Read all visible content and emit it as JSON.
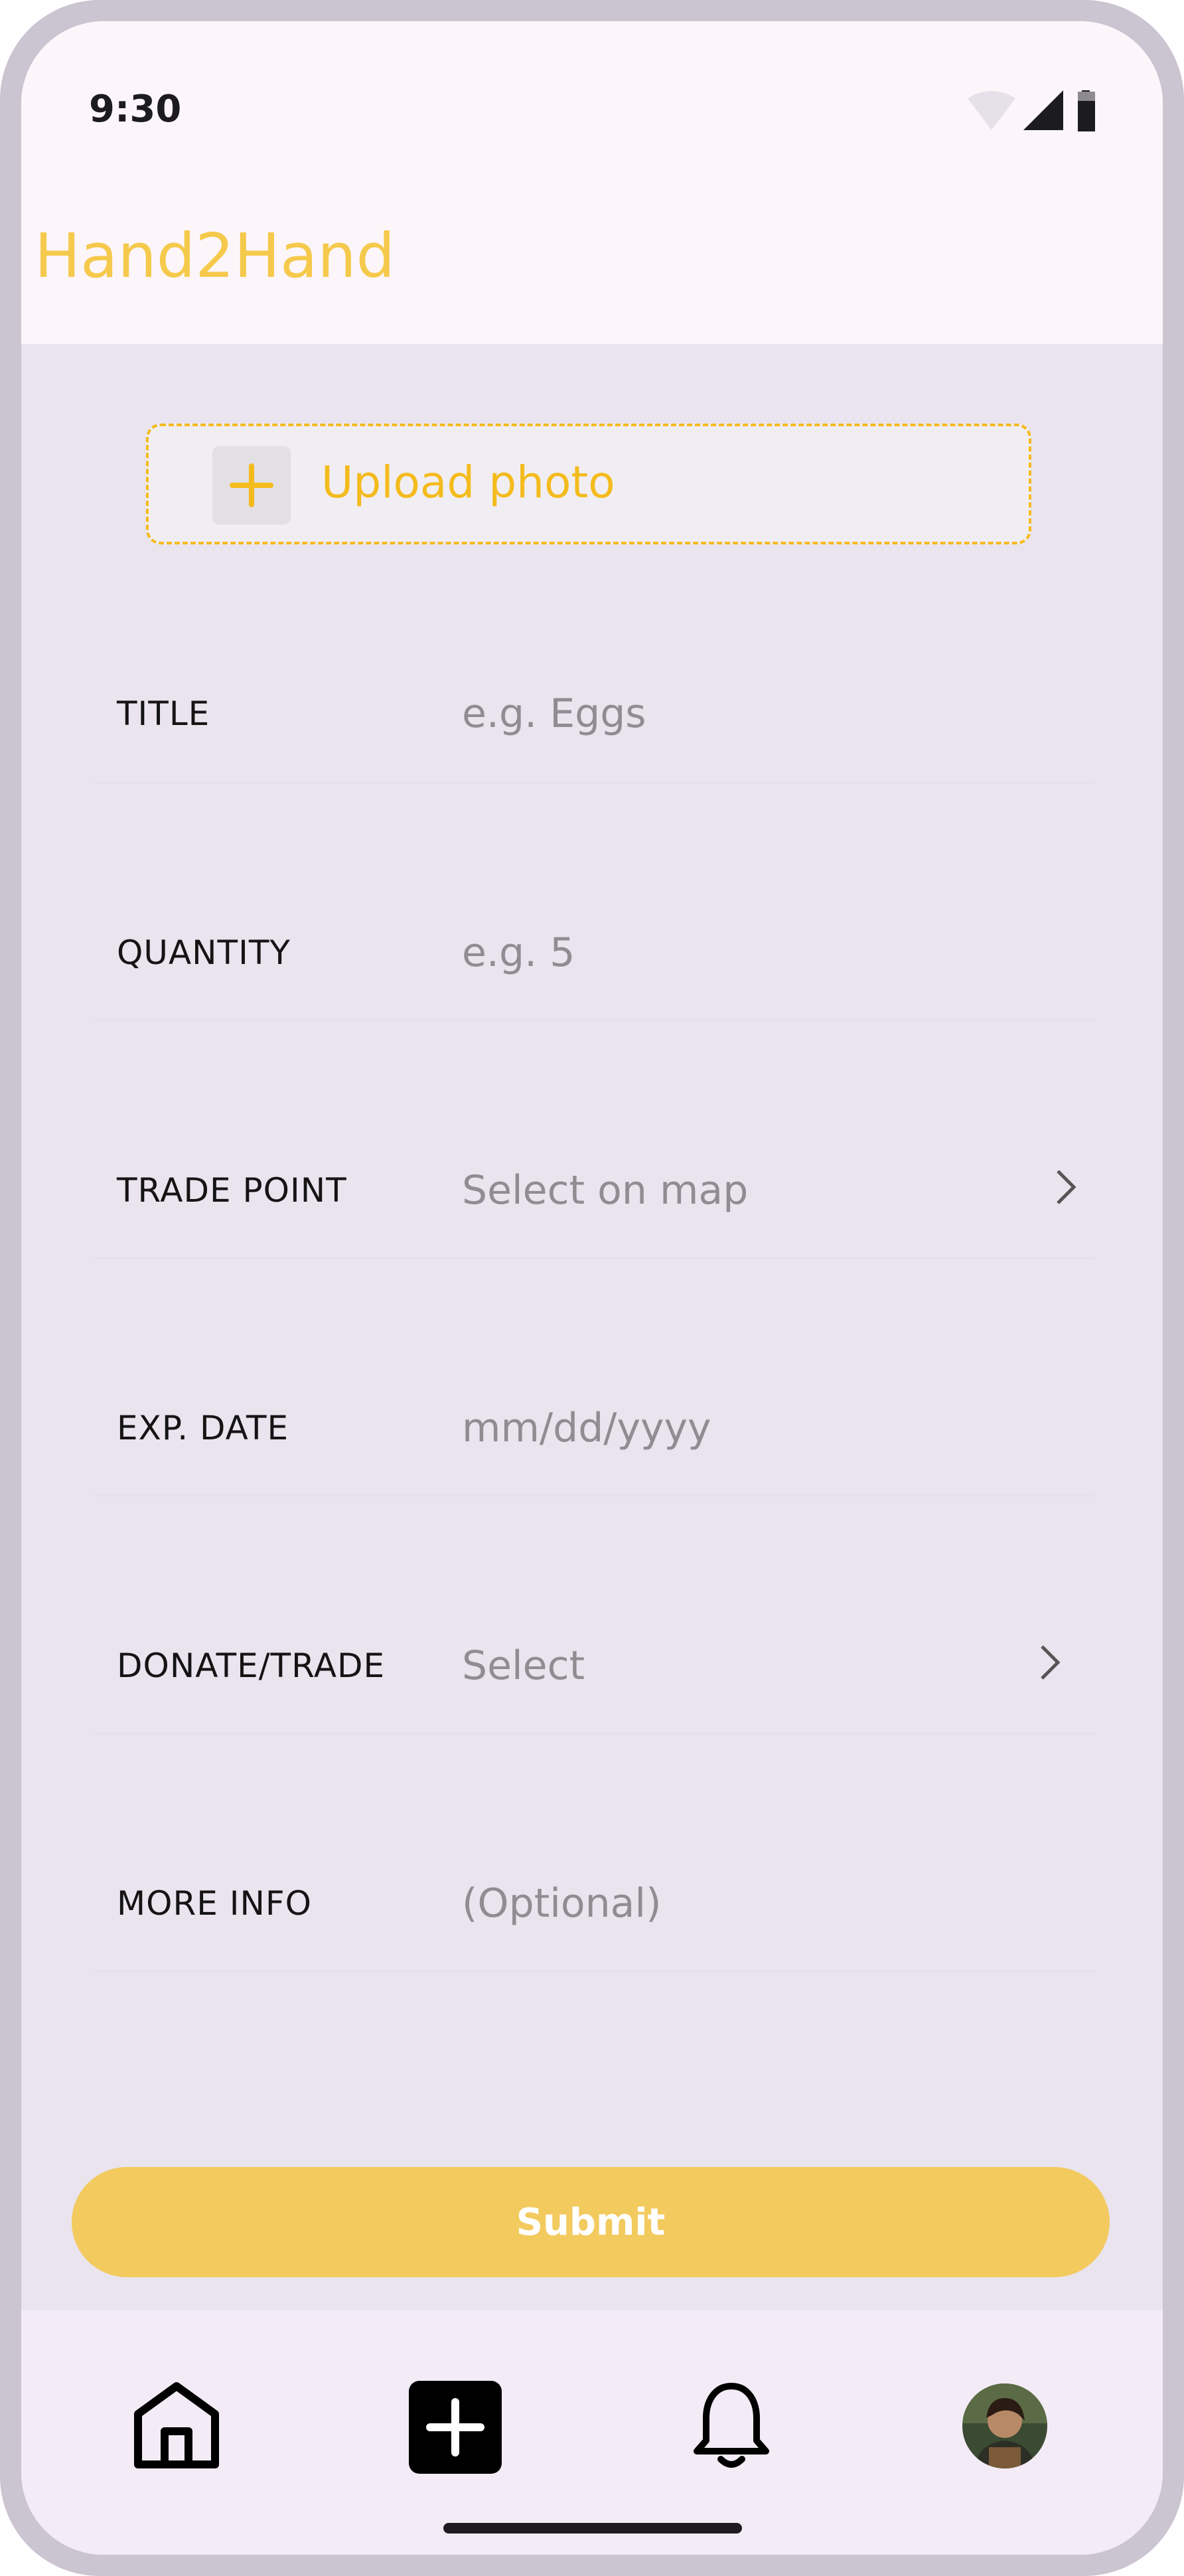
{
  "status_bar": {
    "time": "9:30",
    "icons": [
      "wifi-icon",
      "signal-icon",
      "battery-icon"
    ]
  },
  "header": {
    "app_name": "Hand2Hand"
  },
  "upload": {
    "label": "Upload photo",
    "icon": "plus-icon"
  },
  "form": {
    "rows": [
      {
        "label": "TITLE",
        "value": "e.g. Eggs",
        "chevron": false
      },
      {
        "label": "QUANTITY",
        "value": "e.g. 5",
        "chevron": false
      },
      {
        "label": "TRADE POINT",
        "value": "Select on map",
        "chevron": true
      },
      {
        "label": "EXP. DATE",
        "value": "mm/dd/yyyy",
        "chevron": false
      },
      {
        "label": "DONATE/TRADE",
        "value": "Select",
        "chevron": true
      },
      {
        "label": "MORE INFO",
        "value": "(Optional)",
        "chevron": false
      }
    ]
  },
  "submit": {
    "label": "Submit"
  },
  "bottom_nav": {
    "items": [
      "home-icon",
      "add-icon",
      "bell-icon",
      "avatar"
    ]
  },
  "colors": {
    "accent": "#f4bb1d",
    "submit": "#f2ca5e",
    "title": "#f5c94b",
    "background": "#e9e4ee"
  }
}
